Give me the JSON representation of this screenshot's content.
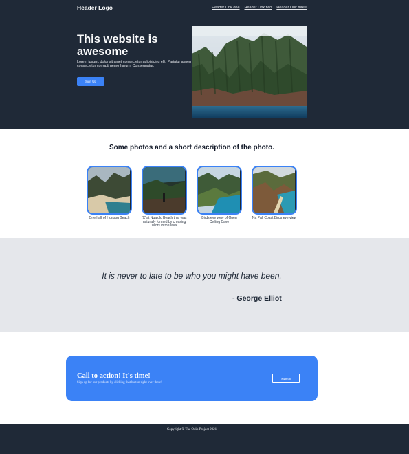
{
  "header": {
    "logo": "Header Logo",
    "links": [
      "Header Link one",
      "Header Link two",
      "Header Link three"
    ]
  },
  "hero": {
    "title": "This website is awesome",
    "text": "Lorem ipsum, dolor sit amet consectetur adipisicing elit. Pariatur aspernatur consectetur corrupti nemo harum. Consequatur.",
    "button_label": "Sign Up"
  },
  "photos": {
    "title": "Some photos and a short description of the photo.",
    "items": [
      {
        "caption": "One half of Honopu Beach"
      },
      {
        "caption": "'X' at Nualolo Beach that was naturally formed by crossing vents in the lava"
      },
      {
        "caption": "Birds eye view of Open Ceiling Cave"
      },
      {
        "caption": "Na Pali Coast Birds eye view"
      }
    ]
  },
  "quote": {
    "text": "It is never to late to be who you might have been.",
    "author": "- George Elliot"
  },
  "cta": {
    "title": "Call to action! It's time!",
    "subtitle": "Sign up for our products by clicking that button right over there!",
    "button_label": "Sign up"
  },
  "footer": {
    "text": "Copyright © The Odin Project 2021"
  },
  "colors": {
    "dark": "#1f2937",
    "accent": "#3b82f6",
    "band": "#e5e7eb"
  }
}
